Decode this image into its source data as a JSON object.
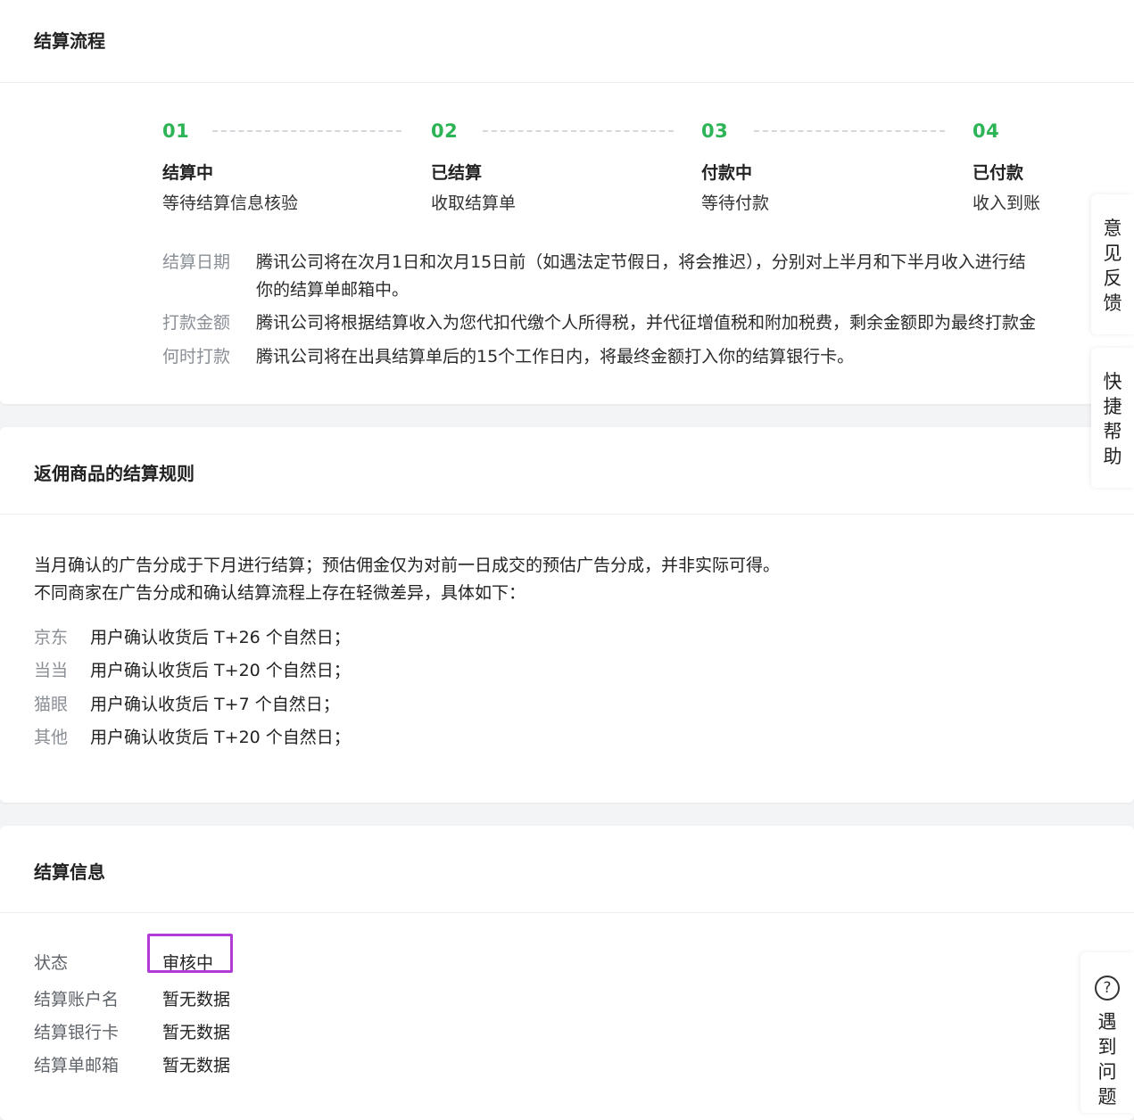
{
  "settlement_flow": {
    "title": "结算流程",
    "steps": [
      {
        "num": "01",
        "title": "结算中",
        "desc": "等待结算信息核验"
      },
      {
        "num": "02",
        "title": "已结算",
        "desc": "收取结算单"
      },
      {
        "num": "03",
        "title": "付款中",
        "desc": "等待付款"
      },
      {
        "num": "04",
        "title": "已付款",
        "desc": "收入到账"
      }
    ],
    "info": [
      {
        "label": "结算日期",
        "text": "腾讯公司将在次月1日和次月15日前（如遇法定节假日，将会推迟），分别对上半月和下半月收入进行结",
        "cont": "你的结算单邮箱中。"
      },
      {
        "label": "打款金额",
        "text": "腾讯公司将根据结算收入为您代扣代缴个人所得税，并代征增值税和附加税费，剩余金额即为最终打款金"
      },
      {
        "label": "何时打款",
        "text": "腾讯公司将在出具结算单后的15个工作日内，将最终金额打入你的结算银行卡。"
      }
    ],
    "accent_color": "#2db456"
  },
  "rebate_rules": {
    "title": "返佣商品的结算规则",
    "line1": "当月确认的广告分成于下月进行结算；预估佣金仅为对前一日成交的预估广告分成，并非实际可得。",
    "line2": "不同商家在广告分成和确认结算流程上存在轻微差异，具体如下：",
    "merchants": [
      {
        "name": "京东",
        "rule": "用户确认收货后 T+26 个自然日；"
      },
      {
        "name": "当当",
        "rule": "用户确认收货后 T+20 个自然日；"
      },
      {
        "name": "猫眼",
        "rule": "用户确认收货后 T+7 个自然日；"
      },
      {
        "name": "其他",
        "rule": "用户确认收货后 T+20 个自然日；"
      }
    ]
  },
  "settlement_info": {
    "title": "结算信息",
    "rows": [
      {
        "label": "状态",
        "value": "审核中"
      },
      {
        "label": "结算账户名",
        "value": "暂无数据"
      },
      {
        "label": "结算银行卡",
        "value": "暂无数据"
      },
      {
        "label": "结算单邮箱",
        "value": "暂无数据"
      }
    ],
    "highlight_color": "#b23bd8"
  },
  "side": {
    "feedback": [
      "意",
      "见",
      "反",
      "馈"
    ],
    "help": [
      "快",
      "捷",
      "帮",
      "助"
    ],
    "problem_icon": "question-circle-icon",
    "problem_icon_glyph": "?",
    "problem": [
      "遇",
      "到",
      "问",
      "题"
    ]
  }
}
